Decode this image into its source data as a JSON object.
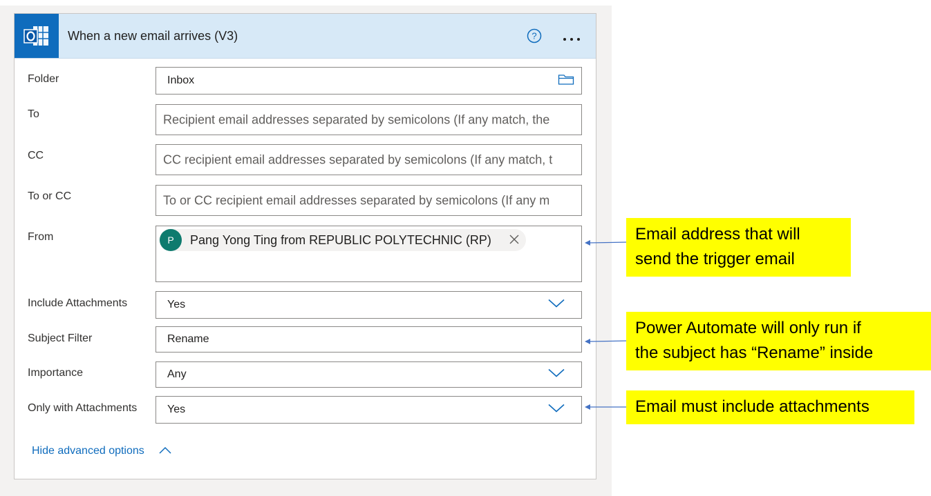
{
  "trigger": {
    "title": "When a new email arrives (V3)",
    "app_icon": "outlook-icon",
    "help_icon": "help-circle-icon",
    "more_icon": "more-horizontal-icon"
  },
  "fields": {
    "folder": {
      "label": "Folder",
      "value": "Inbox",
      "icon": "folder-icon"
    },
    "to": {
      "label": "To",
      "placeholder": "Recipient email addresses separated by semicolons (If any match, the"
    },
    "cc": {
      "label": "CC",
      "placeholder": "CC recipient email addresses separated by semicolons (If any match, t"
    },
    "to_or_cc": {
      "label": "To or CC",
      "placeholder": "To or CC recipient email addresses separated by semicolons (If any m"
    },
    "from": {
      "label": "From",
      "token_initial": "P",
      "token_name": "Pang Yong Ting from REPUBLIC POLYTECHNIC (RP)"
    },
    "include_attachments": {
      "label": "Include Attachments",
      "value": "Yes"
    },
    "subject_filter": {
      "label": "Subject Filter",
      "value": "Rename"
    },
    "importance": {
      "label": "Importance",
      "value": "Any"
    },
    "only_with_attachments": {
      "label": "Only with Attachments",
      "value": "Yes"
    }
  },
  "advanced_toggle": "Hide advanced options",
  "callouts": {
    "from_line1": "Email address that will",
    "from_line2": "send the trigger email",
    "subject_line1": "Power Automate will only run if",
    "subject_line2": "the subject has “Rename” inside",
    "attachments": "Email must include attachments"
  },
  "colors": {
    "header_bg": "#d7e9f7",
    "app_icon_bg": "#0f6cbd",
    "accent": "#0f6cbd",
    "avatar": "#0e7b6e",
    "callout_bg": "#ffff00"
  }
}
